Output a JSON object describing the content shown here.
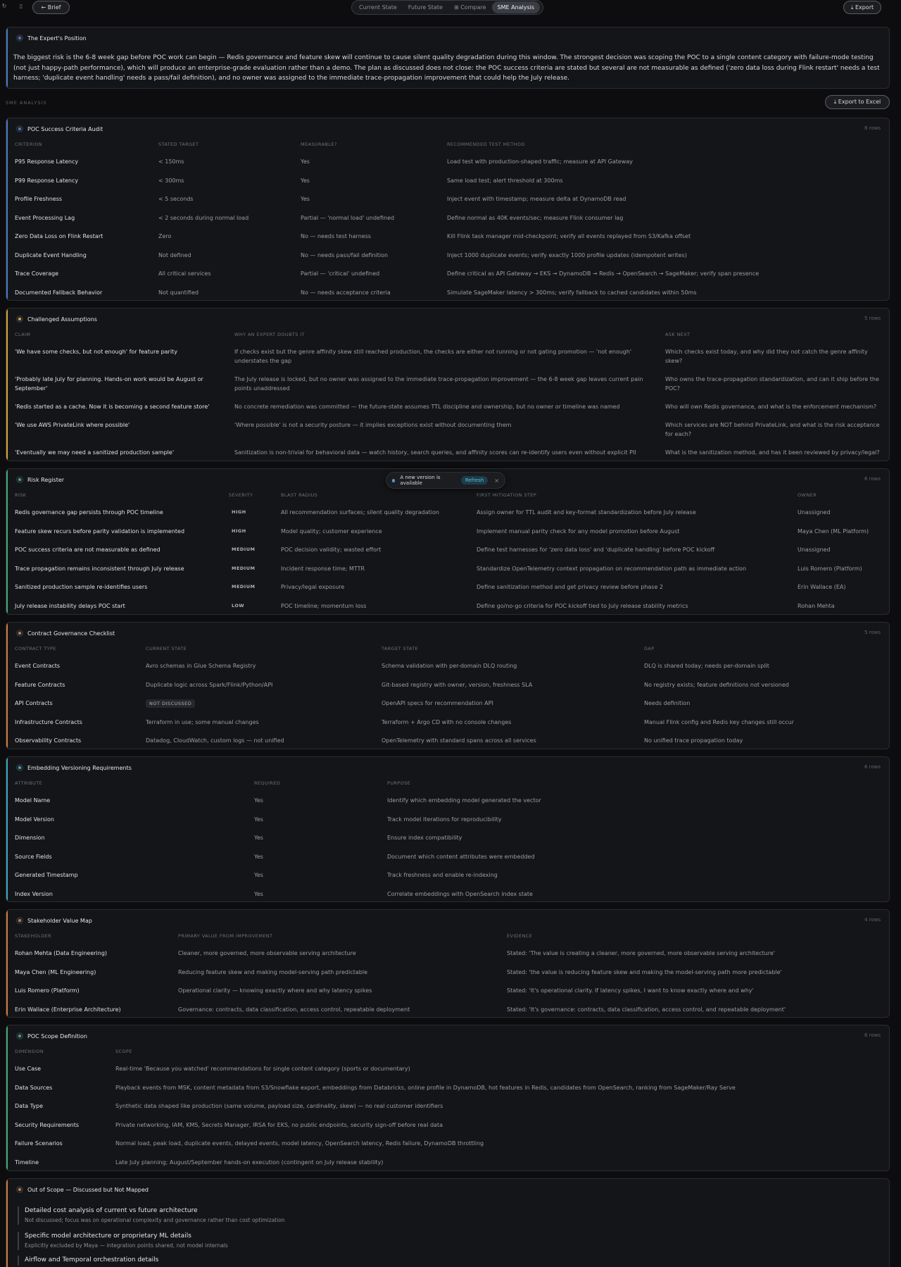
{
  "topbar": {
    "left_icons": [
      "refresh-icon",
      "sidebar-icon"
    ],
    "brief_label": "← Brief",
    "tabs": [
      {
        "label": "Current State",
        "active": false
      },
      {
        "label": "Future State",
        "active": false
      },
      {
        "label": "⊞ Compare",
        "active": false
      },
      {
        "label": "SME Analysis",
        "active": true
      }
    ],
    "export_label": "⤓ Export"
  },
  "expert_position": {
    "title": "The Expert's Position",
    "text": "The biggest risk is the 6-8 week gap before POC work can begin — Redis governance and feature skew will continue to cause silent quality degradation during this window. The strongest decision was scoping the POC to a single content category with failure-mode testing (not just happy-path performance), which will produce an enterprise-grade evaluation rather than a demo. The plan as discussed does not close: the POC success criteria are stated but several are not measurable as defined ('zero data loss during Flink restart' needs a test harness; 'duplicate event handling' needs a pass/fail definition), and no owner was assigned to the immediate trace-propagation improvement that could help the July release."
  },
  "section_label": "SME ANALYSIS",
  "export_excel_label": "⤓ Export to Excel",
  "toast": {
    "text": "A new version is available",
    "button": "Refresh",
    "close": "×"
  },
  "poc_criteria": {
    "title": "POC Success Criteria Audit",
    "count": "8 rows",
    "headers": [
      "CRITERION",
      "STATED TARGET",
      "MEASURABLE?",
      "RECOMMENDED TEST METHOD"
    ],
    "rows": [
      [
        "P95 Response Latency",
        "< 150ms",
        "Yes",
        "Load test with production-shaped traffic; measure at API Gateway"
      ],
      [
        "P99 Response Latency",
        "< 300ms",
        "Yes",
        "Same load test; alert threshold at 300ms"
      ],
      [
        "Profile Freshness",
        "< 5 seconds",
        "Yes",
        "Inject event with timestamp; measure delta at DynamoDB read"
      ],
      [
        "Event Processing Lag",
        "< 2 seconds during normal load",
        "Partial — 'normal load' undefined",
        "Define normal as 40K events/sec; measure Flink consumer lag"
      ],
      [
        "Zero Data Loss on Flink Restart",
        "Zero",
        "No — needs test harness",
        "Kill Flink task manager mid-checkpoint; verify all events replayed from S3/Kafka offset"
      ],
      [
        "Duplicate Event Handling",
        "Not defined",
        "No — needs pass/fail definition",
        "Inject 1000 duplicate events; verify exactly 1000 profile updates (idempotent writes)"
      ],
      [
        "Trace Coverage",
        "All critical services",
        "Partial — 'critical' undefined",
        "Define critical as API Gateway → EKS → DynamoDB → Redis → OpenSearch → SageMaker; verify span presence"
      ],
      [
        "Documented Fallback Behavior",
        "Not quantified",
        "No — needs acceptance criteria",
        "Simulate SageMaker latency > 300ms; verify fallback to cached candidates within 50ms"
      ]
    ]
  },
  "assumptions": {
    "title": "Challenged Assumptions",
    "count": "5 rows",
    "headers": [
      "CLAIM",
      "WHY AN EXPERT DOUBTS IT",
      "ASK NEXT"
    ],
    "rows": [
      [
        "'We have some checks, but not enough' for feature parity",
        "If checks exist but the genre affinity skew still reached production, the checks are either not running or not gating promotion — 'not enough' understates the gap",
        "Which checks exist today, and why did they not catch the genre affinity skew?"
      ],
      [
        "'Probably late July for planning. Hands-on work would be August or September'",
        "The July release is locked, but no owner was assigned to the immediate trace-propagation improvement — the 6-8 week gap leaves current pain points unaddressed",
        "Who owns the trace-propagation standardization, and can it ship before the POC?"
      ],
      [
        "'Redis started as a cache. Now it is becoming a second feature store'",
        "No concrete remediation was committed — the future-state assumes TTL discipline and ownership, but no owner or timeline was named",
        "Who will own Redis governance, and what is the enforcement mechanism?"
      ],
      [
        "'We use AWS PrivateLink where possible'",
        "'Where possible' is not a security posture — it implies exceptions exist without documenting them",
        "Which services are NOT behind PrivateLink, and what is the risk acceptance for each?"
      ],
      [
        "'Eventually we may need a sanitized production sample'",
        "Sanitization is non-trivial for behavioral data — watch history, search queries, and affinity scores can re-identify users even without explicit PII",
        "What is the sanitization method, and has it been reviewed by privacy/legal?"
      ]
    ]
  },
  "risks": {
    "title": "Risk Register",
    "count": "6 rows",
    "headers": [
      "RISK",
      "SEVERITY",
      "BLAST RADIUS",
      "FIRST MITIGATION STEP",
      "OWNER"
    ],
    "rows": [
      [
        "Redis governance gap persists through POC timeline",
        "HIGH",
        "All recommendation surfaces; silent quality degradation",
        "Assign owner for TTL audit and key-format standardization before July release",
        "Unassigned"
      ],
      [
        "Feature skew recurs before parity validation is implemented",
        "HIGH",
        "Model quality; customer experience",
        "Implement manual parity check for any model promotion before August",
        "Maya Chen (ML Platform)"
      ],
      [
        "POC success criteria are not measurable as defined",
        "MEDIUM",
        "POC decision validity; wasted effort",
        "Define test harnesses for 'zero data loss' and 'duplicate handling' before POC kickoff",
        "Unassigned"
      ],
      [
        "Trace propagation remains inconsistent through July release",
        "MEDIUM",
        "Incident response time; MTTR",
        "Standardize OpenTelemetry context propagation on recommendation path as immediate action",
        "Luis Romero (Platform)"
      ],
      [
        "Sanitized production sample re-identifies users",
        "MEDIUM",
        "Privacy/legal exposure",
        "Define sanitization method and get privacy review before phase 2",
        "Erin Wallace (EA)"
      ],
      [
        "July release instability delays POC start",
        "LOW",
        "POC timeline; momentum loss",
        "Define go/no-go criteria for POC kickoff tied to July release stability metrics",
        "Rohan Mehta"
      ]
    ]
  },
  "contracts": {
    "title": "Contract Governance Checklist",
    "count": "5 rows",
    "headers": [
      "CONTRACT TYPE",
      "CURRENT STATE",
      "TARGET STATE",
      "GAP"
    ],
    "rows": [
      [
        "Event Contracts",
        "Avro schemas in Glue Schema Registry",
        "Schema validation with per-domain DLQ routing",
        "DLQ is shared today; needs per-domain split"
      ],
      [
        "Feature Contracts",
        "Duplicate logic across Spark/Flink/Python/API",
        "Git-based registry with owner, version, freshness SLA",
        "No registry exists; feature definitions not versioned"
      ],
      [
        "API Contracts",
        "NOT DISCUSSED",
        "OpenAPI specs for recommendation API",
        "Needs definition"
      ],
      [
        "Infrastructure Contracts",
        "Terraform in use; some manual changes",
        "Terraform + Argo CD with no console changes",
        "Manual Flink config and Redis key changes still occur"
      ],
      [
        "Observability Contracts",
        "Datadog, CloudWatch, custom logs — not unified",
        "OpenTelemetry with standard spans across all services",
        "No unified trace propagation today"
      ]
    ]
  },
  "embedding": {
    "title": "Embedding Versioning Requirements",
    "count": "6 rows",
    "headers": [
      "ATTRIBUTE",
      "REQUIRED",
      "PURPOSE"
    ],
    "rows": [
      [
        "Model Name",
        "Yes",
        "Identify which embedding model generated the vector"
      ],
      [
        "Model Version",
        "Yes",
        "Track model iterations for reproducibility"
      ],
      [
        "Dimension",
        "Yes",
        "Ensure index compatibility"
      ],
      [
        "Source Fields",
        "Yes",
        "Document which content attributes were embedded"
      ],
      [
        "Generated Timestamp",
        "Yes",
        "Track freshness and enable re-indexing"
      ],
      [
        "Index Version",
        "Yes",
        "Correlate embeddings with OpenSearch index state"
      ]
    ]
  },
  "stakeholders": {
    "title": "Stakeholder Value Map",
    "count": "4 rows",
    "headers": [
      "STAKEHOLDER",
      "PRIMARY VALUE FROM IMPROVEMENT",
      "EVIDENCE"
    ],
    "rows": [
      [
        "Rohan Mehta (Data Engineering)",
        "Cleaner, more governed, more observable serving architecture",
        "Stated: 'The value is creating a cleaner, more governed, more observable serving architecture'"
      ],
      [
        "Maya Chen (ML Engineering)",
        "Reducing feature skew and making model-serving path predictable",
        "Stated: 'the value is reducing feature skew and making the model-serving path more predictable'"
      ],
      [
        "Luis Romero (Platform)",
        "Operational clarity — knowing exactly where and why latency spikes",
        "Stated: 'It's operational clarity. If latency spikes, I want to know exactly where and why'"
      ],
      [
        "Erin Wallace (Enterprise Architecture)",
        "Governance: contracts, data classification, access control, repeatable deployment",
        "Stated: 'It's governance: contracts, data classification, access control, and repeatable deployment'"
      ]
    ]
  },
  "scope": {
    "title": "POC Scope Definition",
    "count": "6 rows",
    "headers": [
      "DIMENSION",
      "SCOPE"
    ],
    "rows": [
      [
        "Use Case",
        "Real-time 'Because you watched' recommendations for single content category (sports or documentary)"
      ],
      [
        "Data Sources",
        "Playback events from MSK, content metadata from S3/Snowflake export, embeddings from Databricks, online profile in DynamoDB, hot features in Redis, candidates from OpenSearch, ranking from SageMaker/Ray Serve"
      ],
      [
        "Data Type",
        "Synthetic data shaped like production (same volume, payload size, cardinality, skew) — no real customer identifiers"
      ],
      [
        "Security Requirements",
        "Private networking, IAM, KMS, Secrets Manager, IRSA for EKS, no public endpoints, security sign-off before real data"
      ],
      [
        "Failure Scenarios",
        "Normal load, peak load, duplicate events, delayed events, model latency, OpenSearch latency, Redis failure, DynamoDB throttling"
      ],
      [
        "Timeline",
        "Late July planning; August/September hands-on execution (contingent on July release stability)"
      ]
    ]
  },
  "out_of_scope": {
    "title": "Out of Scope — Discussed but Not Mapped",
    "items": [
      {
        "title": "Detailed cost analysis of current vs future architecture",
        "sub": "Not discussed; focus was on operational complexity and governance rather than cost optimization"
      },
      {
        "title": "Specific model architecture or proprietary ML details",
        "sub": "Explicitly excluded by Maya — integration points shared, not model internals"
      },
      {
        "title": "Airflow and Temporal orchestration details",
        "sub": ""
      }
    ]
  },
  "colors": {
    "blue": "#4a78c9",
    "amber": "#d4a43a",
    "green": "#3fa877",
    "orange": "#d07a3a",
    "teal": "#3aa7c0"
  }
}
